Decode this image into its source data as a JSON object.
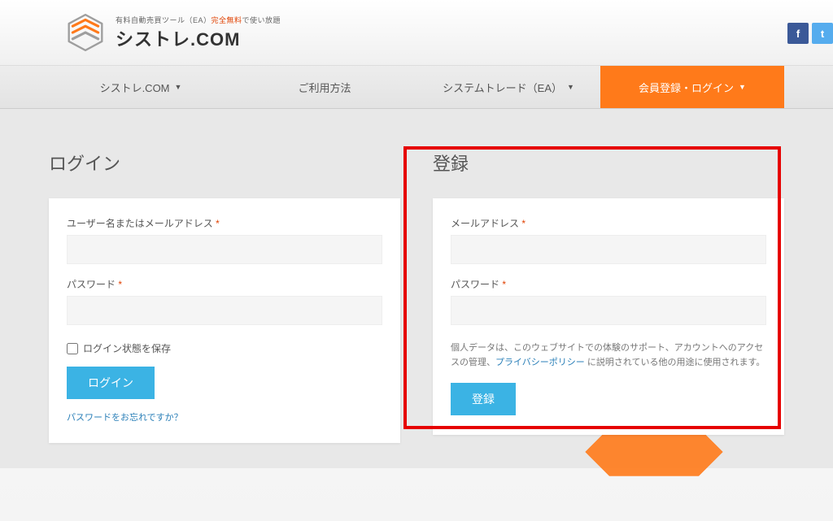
{
  "header": {
    "tagline_prefix": "有料自動売買ツール（EA）",
    "tagline_em": "完全無料",
    "tagline_suffix": "で使い放題",
    "brand": "シストレ.COM"
  },
  "nav": {
    "items": [
      {
        "label": "シストレ.COM"
      },
      {
        "label": "ご利用方法"
      },
      {
        "label": "システムトレード（EA）"
      },
      {
        "label": "会員登録・ログイン"
      }
    ]
  },
  "login": {
    "heading": "ログイン",
    "username_label": "ユーザー名またはメールアドレス",
    "password_label": "パスワード",
    "remember_label": "ログイン状態を保存",
    "submit": "ログイン",
    "forgot": "パスワードをお忘れですか？"
  },
  "register": {
    "heading": "登録",
    "email_label": "メールアドレス",
    "password_label": "パスワード",
    "privacy_prefix": "個人データは、このウェブサイトでの体験のサポート、アカウントへのアクセスの管理、",
    "privacy_link": "プライバシーポリシー",
    "privacy_suffix": " に説明されている他の用途に使用されます。",
    "submit": "登録"
  }
}
